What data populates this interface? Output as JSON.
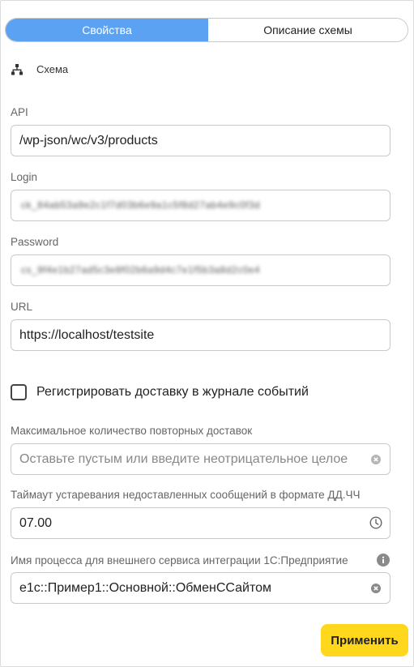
{
  "tabs": [
    {
      "label": "Свойства",
      "active": true
    },
    {
      "label": "Описание схемы",
      "active": false
    }
  ],
  "schema": {
    "label": "Схема",
    "icon": "hierarchy-icon"
  },
  "fields": {
    "api": {
      "label": "API",
      "value": "/wp-json/wc/v3/products"
    },
    "login": {
      "label": "Login",
      "value": "ck_84ab53a9e2c1f7d03b6e9a1c5f8d27ab4e9c0f3d"
    },
    "password": {
      "label": "Password",
      "value": "cs_9f4e1b27ad5c3e8f02b6a9d4c7e1f5b3a8d2c0e4"
    },
    "url": {
      "label": "URL",
      "value": "https://localhost/testsite"
    },
    "max_retries": {
      "label": "Максимальное количество повторных доставок",
      "placeholder": "Оставьте пустым или введите неотрицательное целое"
    },
    "timeout": {
      "label": "Таймаут устаревания недоставленных сообщений в формате ДД.ЧЧ",
      "value": "07.00"
    },
    "process_name": {
      "label": "Имя процесса для внешнего сервиса интеграции 1С:Предприятие",
      "value": "e1c::Пример1::Основной::ОбменССайтом"
    }
  },
  "checkbox": {
    "label": "Регистрировать доставку в журнале событий",
    "checked": false
  },
  "apply_button": {
    "label": "Применить",
    "color": "#ffd81e"
  },
  "accent_color": "#5ba3f2"
}
